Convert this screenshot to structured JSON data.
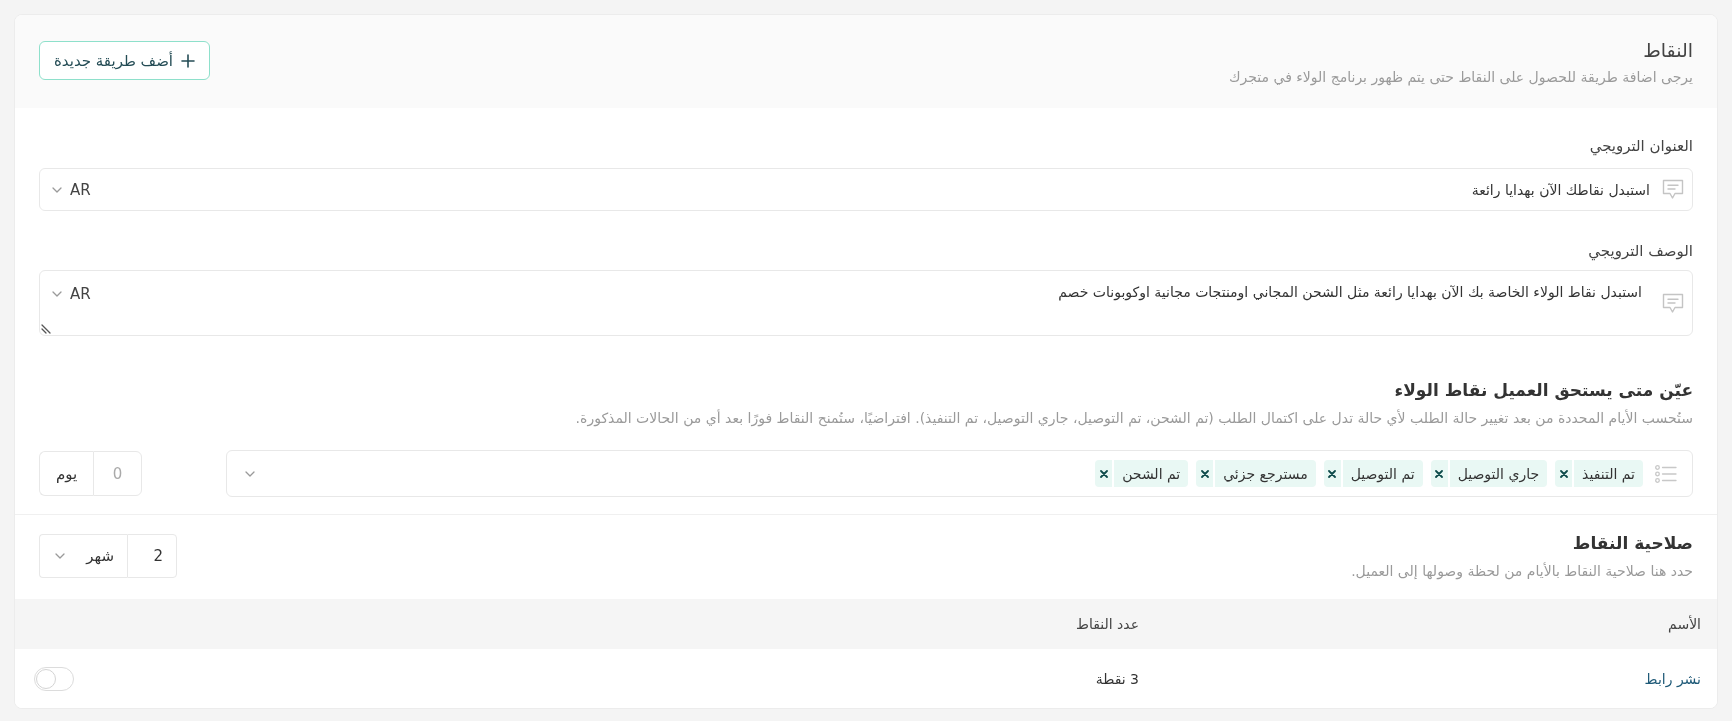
{
  "header": {
    "title": "النقاط",
    "subtitle": "يرجى اضافة طريقة للحصول على النقاط حتى يتم ظهور برنامج الولاء في متجرك",
    "add_button": "أضف طريقة جديدة"
  },
  "promo_title": {
    "label": "العنوان الترويجي",
    "value": "استبدل نقاطك الآن بهدايا رائعة",
    "language": "AR"
  },
  "promo_description": {
    "label": "الوصف الترويجي",
    "value": "استبدل نقاط الولاء الخاصة بك الآن بهدايا رائعة مثل الشحن المجاني اومنتجات مجانية اوكوبونات خصم",
    "language": "AR"
  },
  "eligibility": {
    "title": "عيّن متى يستحق العميل نقاط الولاء",
    "description": "ستُحسب الأيام المحددة من بعد تغيير حالة الطلب لأي حالة تدل على اكتمال الطلب (تم الشحن، تم التوصيل، جاري التوصيل، تم التنفيذ). افتراضيًا، ستُمنح النقاط فورًا بعد أي من الحالات المذكورة.",
    "statuses": [
      "تم التنفيذ",
      "جاري التوصيل",
      "تم التوصيل",
      "مسترجع جزئي",
      "تم الشحن"
    ],
    "days": {
      "placeholder": "0",
      "unit": "يوم"
    }
  },
  "validity": {
    "title": "صلاحية النقاط",
    "description": "حدد هنا صلاحية النقاط بالأيام من لحظة وصولها إلى العميل.",
    "value": "2",
    "unit": "شهر"
  },
  "table": {
    "columns": [
      "الأسم",
      "عدد النقاط"
    ],
    "rows": [
      {
        "name": "نشر رابط",
        "points": "3 نقطة",
        "on": false
      }
    ]
  }
}
